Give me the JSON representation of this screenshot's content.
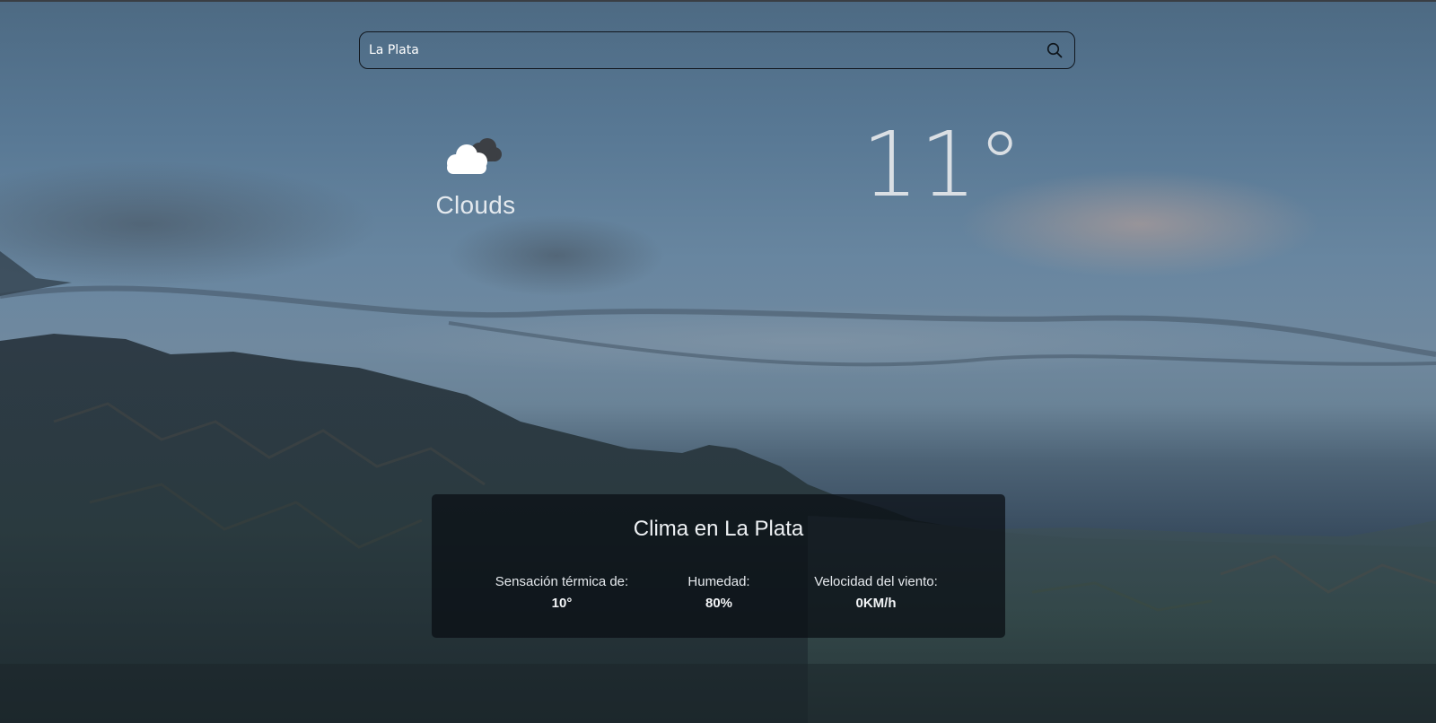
{
  "search": {
    "value": "La Plata",
    "placeholder": "",
    "icon": "search-icon"
  },
  "current": {
    "icon": "clouds-icon",
    "condition": "Clouds",
    "temperature": "11°"
  },
  "details": {
    "title": "Clima en La Plata",
    "feels_like_label": "Sensación térmica de:",
    "feels_like_value": "10°",
    "humidity_label": "Humedad:",
    "humidity_value": "80%",
    "wind_label": "Velocidad del viento:",
    "wind_value": "0KM/h"
  },
  "colors": {
    "card_background": "#0d1218",
    "text_primary": "#e6eaee",
    "search_border": "#10161d"
  }
}
